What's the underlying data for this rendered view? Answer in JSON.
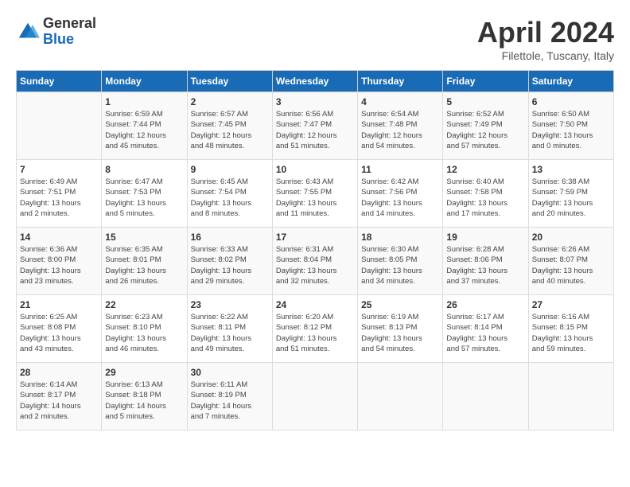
{
  "logo": {
    "general": "General",
    "blue": "Blue"
  },
  "title": "April 2024",
  "subtitle": "Filettole, Tuscany, Italy",
  "days_header": [
    "Sunday",
    "Monday",
    "Tuesday",
    "Wednesday",
    "Thursday",
    "Friday",
    "Saturday"
  ],
  "weeks": [
    [
      {
        "day": "",
        "info": ""
      },
      {
        "day": "1",
        "info": "Sunrise: 6:59 AM\nSunset: 7:44 PM\nDaylight: 12 hours\nand 45 minutes."
      },
      {
        "day": "2",
        "info": "Sunrise: 6:57 AM\nSunset: 7:45 PM\nDaylight: 12 hours\nand 48 minutes."
      },
      {
        "day": "3",
        "info": "Sunrise: 6:56 AM\nSunset: 7:47 PM\nDaylight: 12 hours\nand 51 minutes."
      },
      {
        "day": "4",
        "info": "Sunrise: 6:54 AM\nSunset: 7:48 PM\nDaylight: 12 hours\nand 54 minutes."
      },
      {
        "day": "5",
        "info": "Sunrise: 6:52 AM\nSunset: 7:49 PM\nDaylight: 12 hours\nand 57 minutes."
      },
      {
        "day": "6",
        "info": "Sunrise: 6:50 AM\nSunset: 7:50 PM\nDaylight: 13 hours\nand 0 minutes."
      }
    ],
    [
      {
        "day": "7",
        "info": "Sunrise: 6:49 AM\nSunset: 7:51 PM\nDaylight: 13 hours\nand 2 minutes."
      },
      {
        "day": "8",
        "info": "Sunrise: 6:47 AM\nSunset: 7:53 PM\nDaylight: 13 hours\nand 5 minutes."
      },
      {
        "day": "9",
        "info": "Sunrise: 6:45 AM\nSunset: 7:54 PM\nDaylight: 13 hours\nand 8 minutes."
      },
      {
        "day": "10",
        "info": "Sunrise: 6:43 AM\nSunset: 7:55 PM\nDaylight: 13 hours\nand 11 minutes."
      },
      {
        "day": "11",
        "info": "Sunrise: 6:42 AM\nSunset: 7:56 PM\nDaylight: 13 hours\nand 14 minutes."
      },
      {
        "day": "12",
        "info": "Sunrise: 6:40 AM\nSunset: 7:58 PM\nDaylight: 13 hours\nand 17 minutes."
      },
      {
        "day": "13",
        "info": "Sunrise: 6:38 AM\nSunset: 7:59 PM\nDaylight: 13 hours\nand 20 minutes."
      }
    ],
    [
      {
        "day": "14",
        "info": "Sunrise: 6:36 AM\nSunset: 8:00 PM\nDaylight: 13 hours\nand 23 minutes."
      },
      {
        "day": "15",
        "info": "Sunrise: 6:35 AM\nSunset: 8:01 PM\nDaylight: 13 hours\nand 26 minutes."
      },
      {
        "day": "16",
        "info": "Sunrise: 6:33 AM\nSunset: 8:02 PM\nDaylight: 13 hours\nand 29 minutes."
      },
      {
        "day": "17",
        "info": "Sunrise: 6:31 AM\nSunset: 8:04 PM\nDaylight: 13 hours\nand 32 minutes."
      },
      {
        "day": "18",
        "info": "Sunrise: 6:30 AM\nSunset: 8:05 PM\nDaylight: 13 hours\nand 34 minutes."
      },
      {
        "day": "19",
        "info": "Sunrise: 6:28 AM\nSunset: 8:06 PM\nDaylight: 13 hours\nand 37 minutes."
      },
      {
        "day": "20",
        "info": "Sunrise: 6:26 AM\nSunset: 8:07 PM\nDaylight: 13 hours\nand 40 minutes."
      }
    ],
    [
      {
        "day": "21",
        "info": "Sunrise: 6:25 AM\nSunset: 8:08 PM\nDaylight: 13 hours\nand 43 minutes."
      },
      {
        "day": "22",
        "info": "Sunrise: 6:23 AM\nSunset: 8:10 PM\nDaylight: 13 hours\nand 46 minutes."
      },
      {
        "day": "23",
        "info": "Sunrise: 6:22 AM\nSunset: 8:11 PM\nDaylight: 13 hours\nand 49 minutes."
      },
      {
        "day": "24",
        "info": "Sunrise: 6:20 AM\nSunset: 8:12 PM\nDaylight: 13 hours\nand 51 minutes."
      },
      {
        "day": "25",
        "info": "Sunrise: 6:19 AM\nSunset: 8:13 PM\nDaylight: 13 hours\nand 54 minutes."
      },
      {
        "day": "26",
        "info": "Sunrise: 6:17 AM\nSunset: 8:14 PM\nDaylight: 13 hours\nand 57 minutes."
      },
      {
        "day": "27",
        "info": "Sunrise: 6:16 AM\nSunset: 8:15 PM\nDaylight: 13 hours\nand 59 minutes."
      }
    ],
    [
      {
        "day": "28",
        "info": "Sunrise: 6:14 AM\nSunset: 8:17 PM\nDaylight: 14 hours\nand 2 minutes."
      },
      {
        "day": "29",
        "info": "Sunrise: 6:13 AM\nSunset: 8:18 PM\nDaylight: 14 hours\nand 5 minutes."
      },
      {
        "day": "30",
        "info": "Sunrise: 6:11 AM\nSunset: 8:19 PM\nDaylight: 14 hours\nand 7 minutes."
      },
      {
        "day": "",
        "info": ""
      },
      {
        "day": "",
        "info": ""
      },
      {
        "day": "",
        "info": ""
      },
      {
        "day": "",
        "info": ""
      }
    ]
  ]
}
